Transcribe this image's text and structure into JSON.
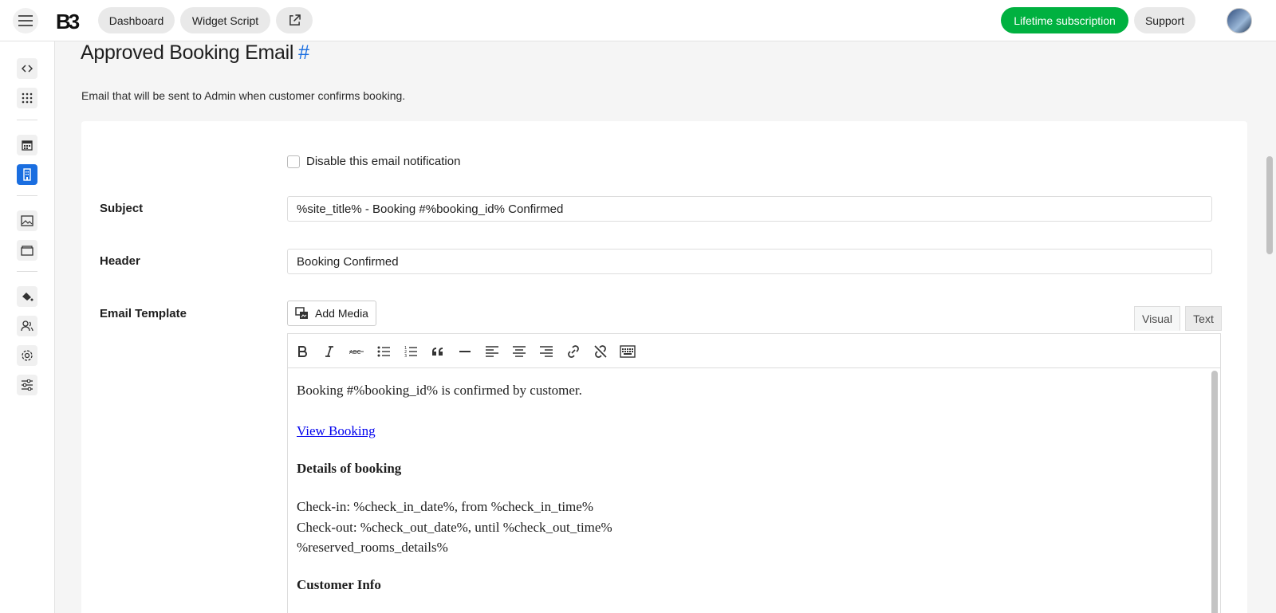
{
  "topbar": {
    "logo_text": "B3",
    "dashboard_label": "Dashboard",
    "widget_label": "Widget Script",
    "lifetime_label": "Lifetime subscription",
    "support_label": "Support"
  },
  "sidebar": {
    "items": [
      "code-icon",
      "grid-icon",
      "calendar-icon",
      "building-icon",
      "image-icon",
      "archive-icon",
      "paint-bucket-icon",
      "users-icon",
      "gear-icon",
      "sliders-icon"
    ],
    "active_item": "building-icon",
    "accent_color": "#1a6ee0"
  },
  "page": {
    "title": "Approved Booking Email",
    "title_hash": "#",
    "description": "Email that will be sent to Admin when customer confirms booking."
  },
  "form": {
    "disable_label": "Disable this email notification",
    "disable_checked": false,
    "subject_label": "Subject",
    "subject_value": "%site_title% - Booking #%booking_id% Confirmed",
    "header_label": "Header",
    "header_value": "Booking Confirmed",
    "template_label": "Email Template",
    "add_media_label": "Add Media",
    "tab_visual": "Visual",
    "tab_text": "Text"
  },
  "toolbar_icons": [
    "bold-icon",
    "italic-icon",
    "strikethrough-icon",
    "bullet-list-icon",
    "numbered-list-icon",
    "blockquote-icon",
    "horizontal-rule-icon",
    "align-left-icon",
    "align-center-icon",
    "align-right-icon",
    "link-icon",
    "unlink-icon",
    "toolbar-toggle-icon"
  ],
  "editor": {
    "line1": "Booking #%booking_id% is confirmed by customer.",
    "link_text": "View Booking",
    "details_heading": "Details of booking",
    "checkin_line": "Check-in: %check_in_date%, from %check_in_time%",
    "checkout_line": "Check-out: %check_out_date%, until %check_out_time%",
    "rooms_line": "%reserved_rooms_details%",
    "customer_heading": "Customer Info"
  },
  "colors": {
    "brand_green": "#00b140",
    "accent_blue": "#1a6ee0"
  }
}
